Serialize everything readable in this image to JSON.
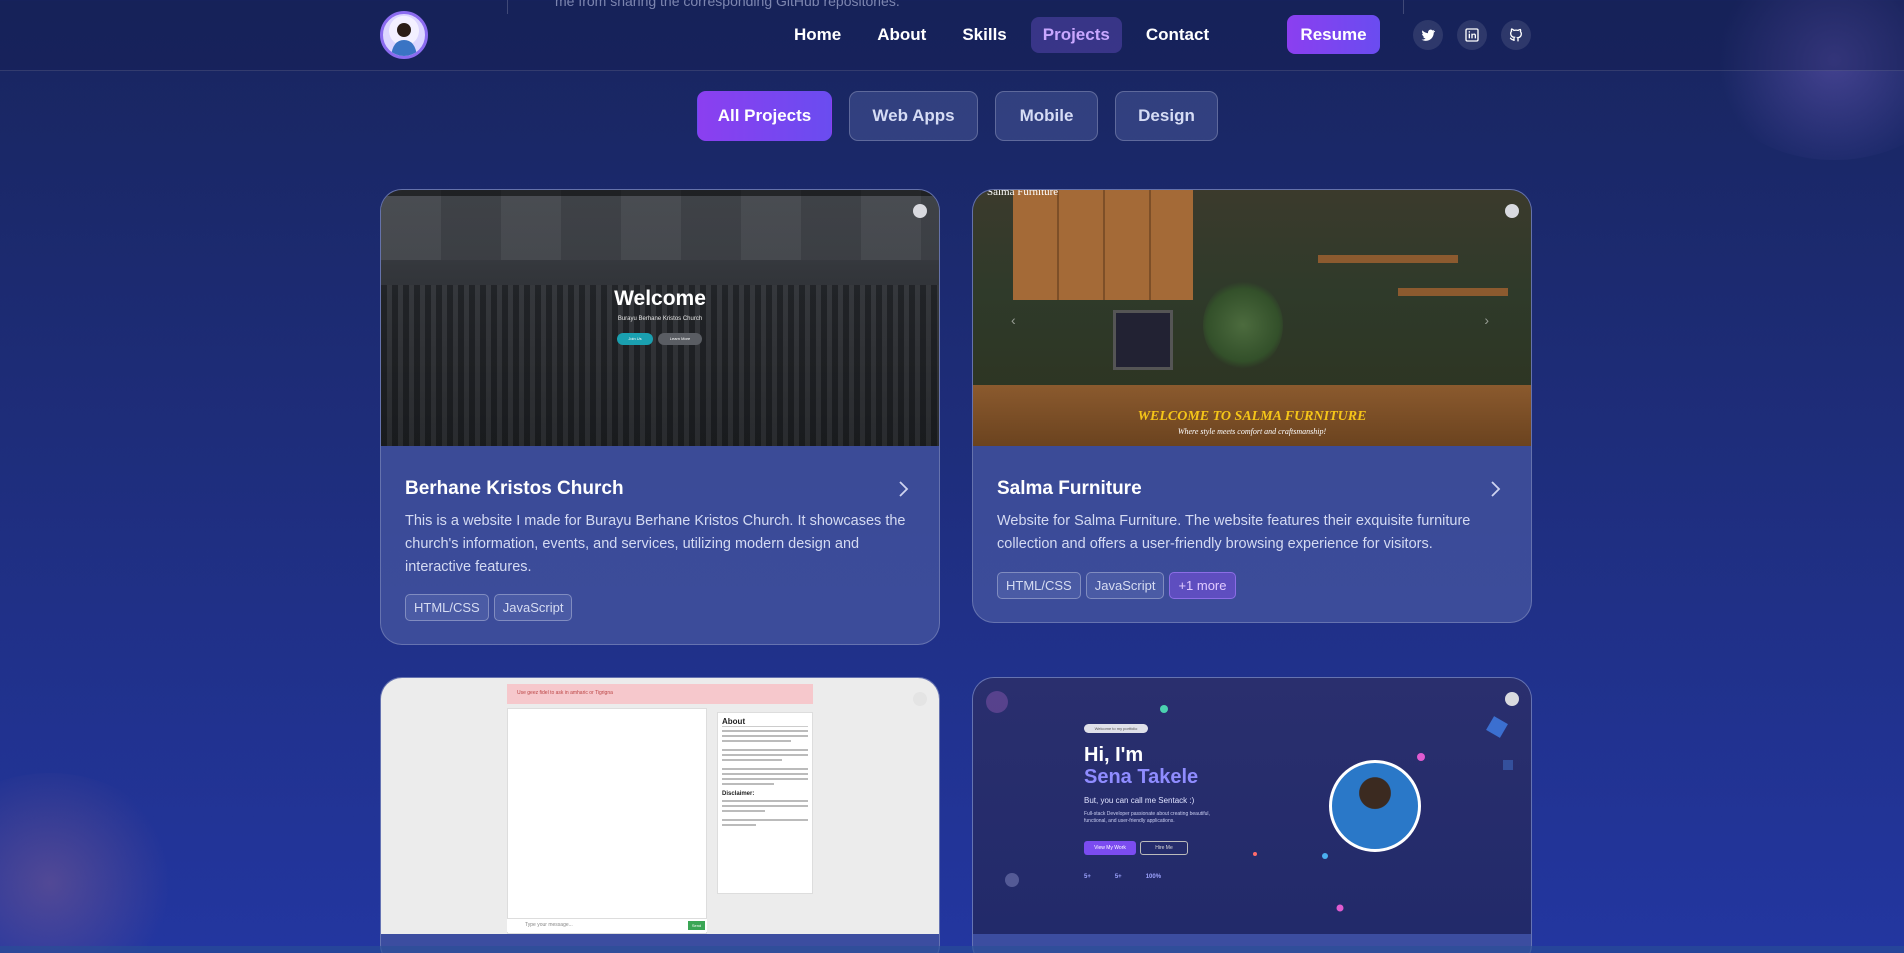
{
  "header": {
    "peek_text": "me from sharing the corresponding GitHub repositories.",
    "nav": [
      "Home",
      "About",
      "Skills",
      "Projects",
      "Contact"
    ],
    "active_nav": "Projects",
    "resume_label": "Resume",
    "social_icons": [
      "twitter-icon",
      "linkedin-icon",
      "github-icon"
    ]
  },
  "filters": [
    "All Projects",
    "Web Apps",
    "Mobile",
    "Design"
  ],
  "active_filter": "All Projects",
  "cards": [
    {
      "title": "Berhane Kristos Church",
      "description": "This is a website I made for Burayu Berhane Kristos Church. It showcases the church's information, events, and services, utilizing modern design and interactive features.",
      "tags": [
        "HTML/CSS",
        "JavaScript"
      ],
      "thumb": {
        "welcome": "Welcome",
        "sub": "Burayu Berhane Kristos Church",
        "btn1": "Join Us",
        "btn2": "Learn More"
      }
    },
    {
      "title": "Salma Furniture",
      "description": "Website for Salma Furniture. The website features their exquisite furniture collection and offers a user-friendly browsing experience for visitors.",
      "tags": [
        "HTML/CSS",
        "JavaScript"
      ],
      "more_tag": "+1 more",
      "thumb": {
        "brand": "Salma Furniture",
        "headline": "WELCOME TO SALMA FURNITURE",
        "tagline": "Where style meets comfort and craftsmanship!"
      }
    },
    {
      "title": "",
      "thumb": {
        "banner": "Use geez fidel to ask in amharic or Tigrigna",
        "about_title": "About",
        "disclaimer_title": "Disclaimer:",
        "input_placeholder": "Type your message...",
        "send": "Send"
      }
    },
    {
      "title": "",
      "thumb": {
        "badge": "Welcome to my portfolio",
        "hi": "Hi, I'm",
        "name": "Sena Takele",
        "tagline": "But, you can call me Sentack :)",
        "intro": "Full-stack Developer passionate about creating beautiful, functional, and user-friendly applications.",
        "btn_primary": "View My Work",
        "btn_secondary": "Hire Me",
        "stats": [
          "5+",
          "5+",
          "100%"
        ]
      }
    }
  ],
  "colors": {
    "accent": "#7b4cf0",
    "active_link": "#c9a7ff",
    "bg": "#1e2d7a"
  }
}
